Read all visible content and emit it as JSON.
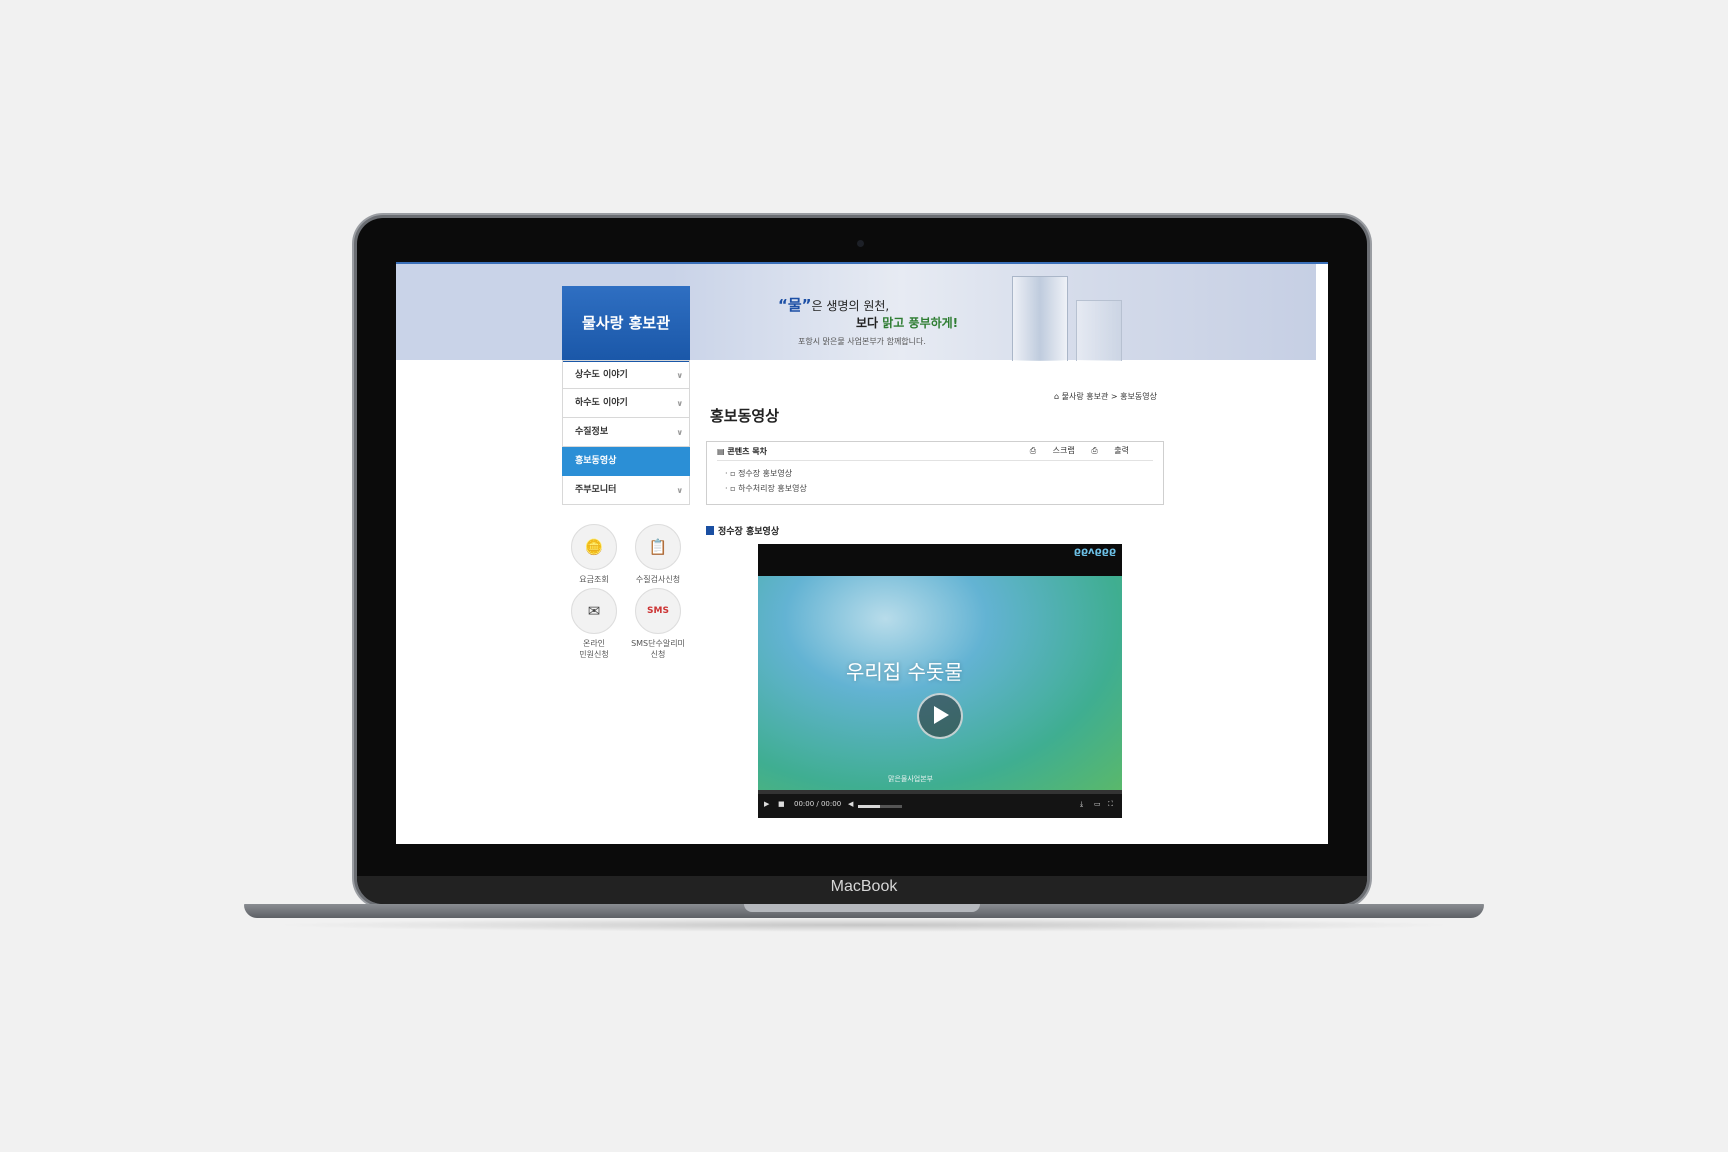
{
  "device": {
    "brand": "MacBook"
  },
  "banner": {
    "title": "물사랑 홍보관",
    "slogan_quote": "“물”",
    "slogan_line1_rest": "은 생명의 원천,",
    "slogan_line2_prefix": "보다 ",
    "slogan_line2_highlight": "맑고 풍부하게!",
    "slogan_sub": "포항시 맑은물 사업본부가 함께합니다."
  },
  "sidebar": {
    "items": [
      {
        "label": "상수도 이야기",
        "active": false
      },
      {
        "label": "하수도 이야기",
        "active": false
      },
      {
        "label": "수질정보",
        "active": false
      },
      {
        "label": "홍보동영상",
        "active": true
      },
      {
        "label": "주부모니터",
        "active": false
      }
    ]
  },
  "quick_links": [
    {
      "label": "요금조회",
      "icon": "coins-icon"
    },
    {
      "label": "수질검사신청",
      "icon": "checklist-icon"
    },
    {
      "label": "온라인\n민원신청",
      "icon": "laptop-mail-icon"
    },
    {
      "label": "SMS단수알리미\n신청",
      "icon": "sms-icon"
    }
  ],
  "breadcrumb": {
    "home": "물사랑 홍보관",
    "separator": ">",
    "current": "홍보동영상"
  },
  "page_title": "홍보동영상",
  "toc": {
    "heading": "콘텐츠 목차",
    "actions": [
      "스크랩",
      "출력"
    ],
    "links": [
      "정수장 홍보영상",
      "하수처리장 홍보영상"
    ]
  },
  "section": {
    "heading": "정수장 홍보영상"
  },
  "video": {
    "logo_text": "ϱϱᴧϱϱϱ",
    "overlay_text": "우리집 수돗물",
    "footer_text": "맑은물사업본부",
    "time": "00:00 / 00:00",
    "progress": 0,
    "volume": 0.5
  },
  "colors": {
    "active_nav": "#2b8fd6",
    "banner_box": "#1a57a8",
    "accent": "#1a4fa2"
  }
}
